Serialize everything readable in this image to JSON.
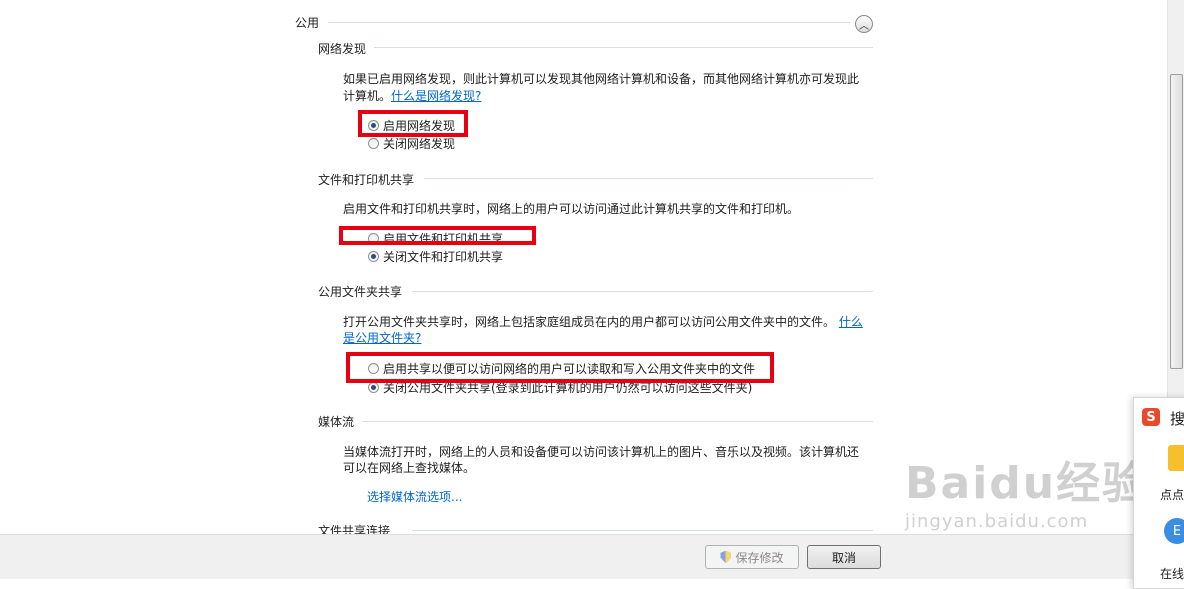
{
  "section": {
    "title": "公用"
  },
  "network_discovery": {
    "title": "网络发现",
    "desc_line1": "如果已启用网络发现，则此计算机可以发现其他网络计算机和设备，而其他网络计算机亦可发现此",
    "desc_line2": "计算机。",
    "link": "什么是网络发现?",
    "option_on": "启用网络发现",
    "option_off": "关闭网络发现",
    "selected": "on"
  },
  "file_printer_sharing": {
    "title": "文件和打印机共享",
    "desc": "启用文件和打印机共享时，网络上的用户可以访问通过此计算机共享的文件和打印机。",
    "option_on": "启用文件和打印机共享",
    "option_off": "关闭文件和打印机共享",
    "selected": "off"
  },
  "public_folder_sharing": {
    "title": "公用文件夹共享",
    "desc_line1": "打开公用文件夹共享时，网络上包括家庭组成员在内的用户都可以访问公用文件夹中的文件。",
    "link_part1": "什么",
    "link_part2": "是公用文件夹?",
    "option_on": "启用共享以便可以访问网络的用户可以读取和写入公用文件夹中的文件",
    "option_off": "关闭公用文件夹共享(登录到此计算机的用户仍然可以访问这些文件夹)",
    "selected": "off"
  },
  "media_streaming": {
    "title": "媒体流",
    "desc_line1": "当媒体流打开时，网络上的人员和设备便可以访问该计算机上的图片、音乐以及视频。该计算机还",
    "desc_line2": "可以在网络上查找媒体。",
    "link": "选择媒体流选项..."
  },
  "file_sharing_connections": {
    "title": "文件共享连接"
  },
  "footer": {
    "save_label": "保存修改",
    "cancel_label": "取消"
  },
  "side_panel": {
    "title": "搜",
    "item1": "点点",
    "item2": "在线",
    "e_icon": "E"
  },
  "watermark": {
    "brand": "Baidu经验",
    "url": "jingyan.baidu.com"
  },
  "colors": {
    "highlight": "#e60012",
    "link": "#0066cc"
  }
}
